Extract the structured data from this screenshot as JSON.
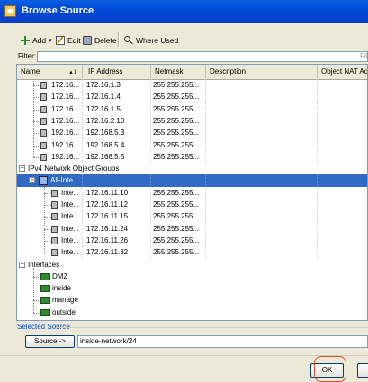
{
  "window": {
    "title": "Browse Source"
  },
  "toolbar": {
    "add": "Add",
    "edit": "Edit",
    "delete": "Delete",
    "where_used": "Where Used"
  },
  "filter": {
    "label": "Filter:",
    "value": "",
    "right_label": "Fil"
  },
  "columns": [
    "Name",
    "IP Address",
    "Netmask",
    "Description",
    "Object NAT Add"
  ],
  "sort_indicator": "1",
  "rows": [
    {
      "kind": "host",
      "name": "172.16...",
      "ip": "172.16.1.3",
      "mask": "255.255.255..."
    },
    {
      "kind": "host",
      "name": "172.16...",
      "ip": "172.16.1.4",
      "mask": "255.255.255..."
    },
    {
      "kind": "host",
      "name": "172.16...",
      "ip": "172.16.1.5",
      "mask": "255.255.255..."
    },
    {
      "kind": "host",
      "name": "172.16...",
      "ip": "172.16.2.10",
      "mask": "255.255.255..."
    },
    {
      "kind": "host",
      "name": "192.16...",
      "ip": "192.168.5.3",
      "mask": "255.255.255..."
    },
    {
      "kind": "host",
      "name": "192.16...",
      "ip": "192.168.5.4",
      "mask": "255.255.255..."
    },
    {
      "kind": "host",
      "name": "192.16...",
      "ip": "192.168.5.5",
      "mask": "255.255.255..."
    },
    {
      "kind": "group",
      "name": "IPv4 Network Object Groups"
    },
    {
      "kind": "objgroup",
      "name": "All-Inte...",
      "selected": true
    },
    {
      "kind": "host2",
      "name": "Inte...",
      "ip": "172.16.11.10",
      "mask": "255.255.255..."
    },
    {
      "kind": "host2",
      "name": "Inte...",
      "ip": "172.16.11.12",
      "mask": "255.255.255..."
    },
    {
      "kind": "host2",
      "name": "Inte...",
      "ip": "172.16.11.15",
      "mask": "255.255.255..."
    },
    {
      "kind": "host2",
      "name": "Inte...",
      "ip": "172.16.11.24",
      "mask": "255.255.255..."
    },
    {
      "kind": "host2",
      "name": "Inte...",
      "ip": "172.16.11.26",
      "mask": "255.255.255..."
    },
    {
      "kind": "host2",
      "name": "Inte...",
      "ip": "172.16.11.32",
      "mask": "255.255.255..."
    },
    {
      "kind": "group",
      "name": "Interfaces"
    },
    {
      "kind": "iface",
      "name": "DMZ"
    },
    {
      "kind": "iface",
      "name": "inside"
    },
    {
      "kind": "iface",
      "name": "manage"
    },
    {
      "kind": "iface",
      "name": "outside"
    }
  ],
  "selected_source": {
    "label": "Selected Source",
    "button": "Source ->",
    "value": "inside-network/24"
  },
  "buttons": {
    "ok": "OK"
  },
  "colors": {
    "selection": "#316ac5",
    "title_bar": "#0054e3",
    "accent_ring": "#e24b2c"
  }
}
